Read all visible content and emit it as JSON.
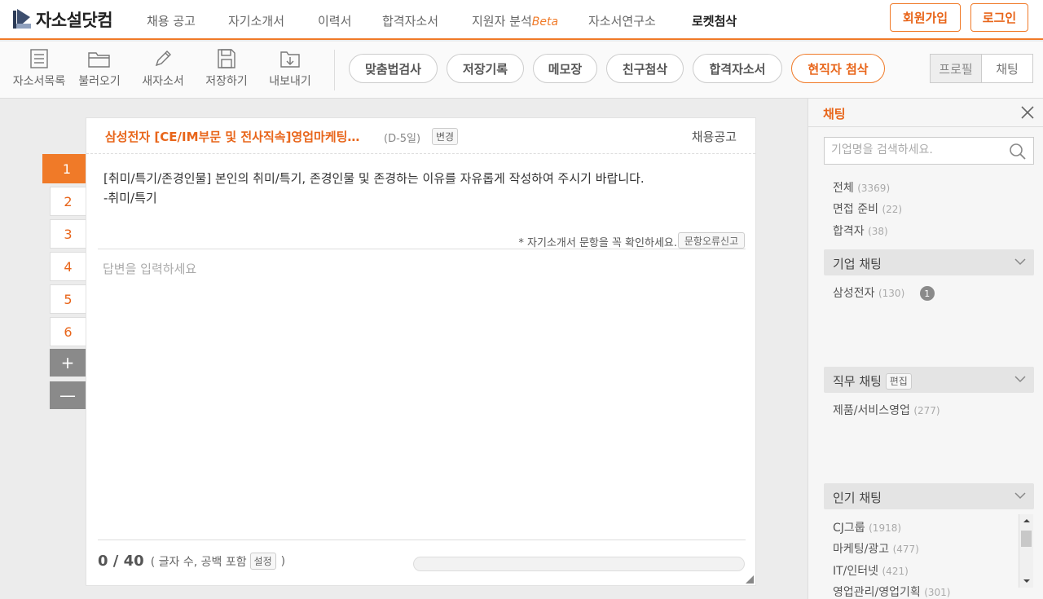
{
  "brand": {
    "name": "자소설닷컴"
  },
  "nav": {
    "items": [
      {
        "label": "채용 공고"
      },
      {
        "label": "자기소개서"
      },
      {
        "label": "이력서"
      },
      {
        "label": "합격자소서"
      },
      {
        "label": "지원자 분석",
        "suffix": "Beta"
      },
      {
        "label": "자소서연구소"
      },
      {
        "label": "로켓첨삭"
      }
    ],
    "signup": "회원가입",
    "login": "로그인"
  },
  "toolbar": {
    "tools": [
      {
        "label": "자소서목록",
        "icon": "list-icon"
      },
      {
        "label": "불러오기",
        "icon": "folder-icon"
      },
      {
        "label": "새자소서",
        "icon": "pencil-icon"
      },
      {
        "label": "저장하기",
        "icon": "save-icon"
      },
      {
        "label": "내보내기",
        "icon": "export-icon"
      }
    ],
    "pills": [
      {
        "label": "맞춤법검사"
      },
      {
        "label": "저장기록"
      },
      {
        "label": "메모장"
      },
      {
        "label": "친구첨삭"
      },
      {
        "label": "합격자소서"
      },
      {
        "label": "현직자 첨삭"
      }
    ],
    "segment": {
      "profile": "프로필",
      "chat": "채팅"
    }
  },
  "questions": {
    "numbers": [
      "1",
      "2",
      "3",
      "4",
      "5",
      "6"
    ],
    "add": "+",
    "remove": "—"
  },
  "editor": {
    "job_title": "삼성전자 [CE/IM부문 및 전사직속]영업마케팅…",
    "dday": "(D-5일)",
    "change": "변경",
    "job_link": "채용공고",
    "question_line1": "[취미/특기/존경인물] 본인의 취미/특기, 존경인물 및 존경하는 이유를 자유롭게 작성하여 주시기 바랍니다.",
    "question_line2": "-취미/특기",
    "note": "* 자기소개서 문항을 꼭 확인하세요.",
    "report": "문항오류신고",
    "answer_placeholder": "답변을 입력하세요",
    "count_current": "0",
    "count_sep": " / ",
    "count_max": "40",
    "count_desc_open": "( 글자 수, 공백 포함",
    "count_setting": "설정",
    "count_desc_close": ")",
    "progress": 0
  },
  "chat": {
    "title": "채팅",
    "search_placeholder": "기업명을 검색하세요.",
    "categories": [
      {
        "label": "전체",
        "count": "(3369)"
      },
      {
        "label": "면접 준비",
        "count": "(22)"
      },
      {
        "label": "합격자",
        "count": "(38)"
      }
    ],
    "company": {
      "title": "기업 채팅",
      "items": [
        {
          "label": "삼성전자",
          "count": "(130)",
          "badge": "1"
        }
      ]
    },
    "job": {
      "title": "직무 채팅",
      "edit": "편집",
      "items": [
        {
          "label": "제품/서비스영업",
          "count": "(277)"
        }
      ]
    },
    "popular": {
      "title": "인기 채팅",
      "items": [
        {
          "label": "CJ그룹",
          "count": "(1918)"
        },
        {
          "label": "마케팅/광고",
          "count": "(477)"
        },
        {
          "label": "IT/인터넷",
          "count": "(421)"
        },
        {
          "label": "영업관리/영업기획",
          "count": "(301)"
        }
      ]
    }
  },
  "colors": {
    "accent": "#f07a28",
    "accent_text": "#e8651a",
    "background": "#ececec"
  }
}
